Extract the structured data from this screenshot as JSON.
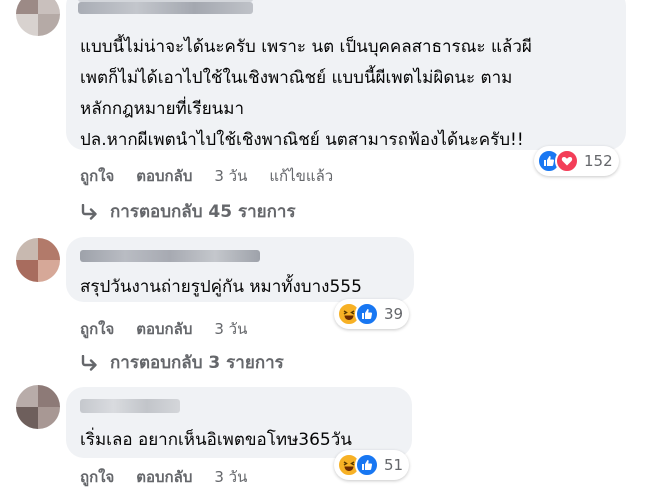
{
  "comments": [
    {
      "author": "Thiraphol Yulingon",
      "lines": [
        "แบบนี้ไม่น่าจะได้นะครับ เพราะ นต เป็นบุคคลสาธารณะ แล้วผี",
        "เพตก็ไม่ได้เอาไปใช้ในเชิงพาณิชย์ แบบนี้ผีเพตไม่ผิดนะ ตาม",
        "หลักกฎหมายที่เรียนมา",
        "ปล.หากผีเพตนำไปใช้เชิงพาณิชย์ นตสามารถฟ้องได้นะครับ!!"
      ],
      "reaction_count": "152",
      "reactions": [
        "like-icon",
        "love-icon"
      ],
      "actions": {
        "like": "ถูกใจ",
        "reply": "ตอบกลับ",
        "time": "3 วัน",
        "edited": "แก้ไขแล้ว"
      },
      "replies_label": "การตอบกลับ 45 รายการ"
    },
    {
      "lines": [
        "สรุปวันงานถ่ายรูปคู่กัน หมาทั้งบาง555"
      ],
      "reaction_count": "39",
      "reactions": [
        "haha-icon",
        "like-icon"
      ],
      "actions": {
        "like": "ถูกใจ",
        "reply": "ตอบกลับ",
        "time": "3 วัน"
      },
      "replies_label": "การตอบกลับ 3 รายการ"
    },
    {
      "lines": [
        "เริ่มเลอ อยากเห็นอิเพตขอโทษ365วัน"
      ],
      "reaction_count": "51",
      "reactions": [
        "haha-icon",
        "like-icon"
      ],
      "actions": {
        "like": "ถูกใจ",
        "reply": "ตอบกลับ",
        "time": "3 วัน"
      }
    }
  ],
  "colors": {
    "bubble": "#f0f2f5",
    "secondary_text": "#65676b",
    "like_blue": "#1877f2",
    "love_red": "#f33e58",
    "haha_yellow": "#f7b125"
  }
}
